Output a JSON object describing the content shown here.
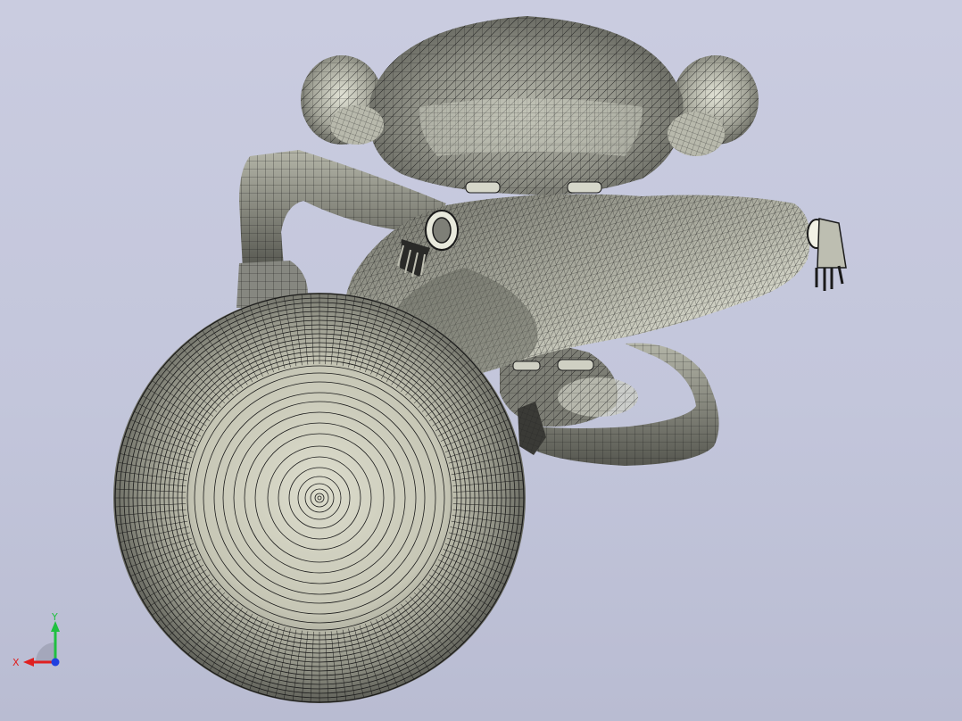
{
  "viewport": {
    "background_top": "#cacce0",
    "background_bottom": "#b9bcd2",
    "model_face_color": "#8c8d84",
    "model_highlight_color": "#d8d9cc",
    "mesh_line_color": "#1a1a1a"
  },
  "triad": {
    "x_label": "X",
    "y_label": "Y",
    "x_color": "#e02020",
    "y_color": "#20c040",
    "z_color": "#2040e0"
  }
}
